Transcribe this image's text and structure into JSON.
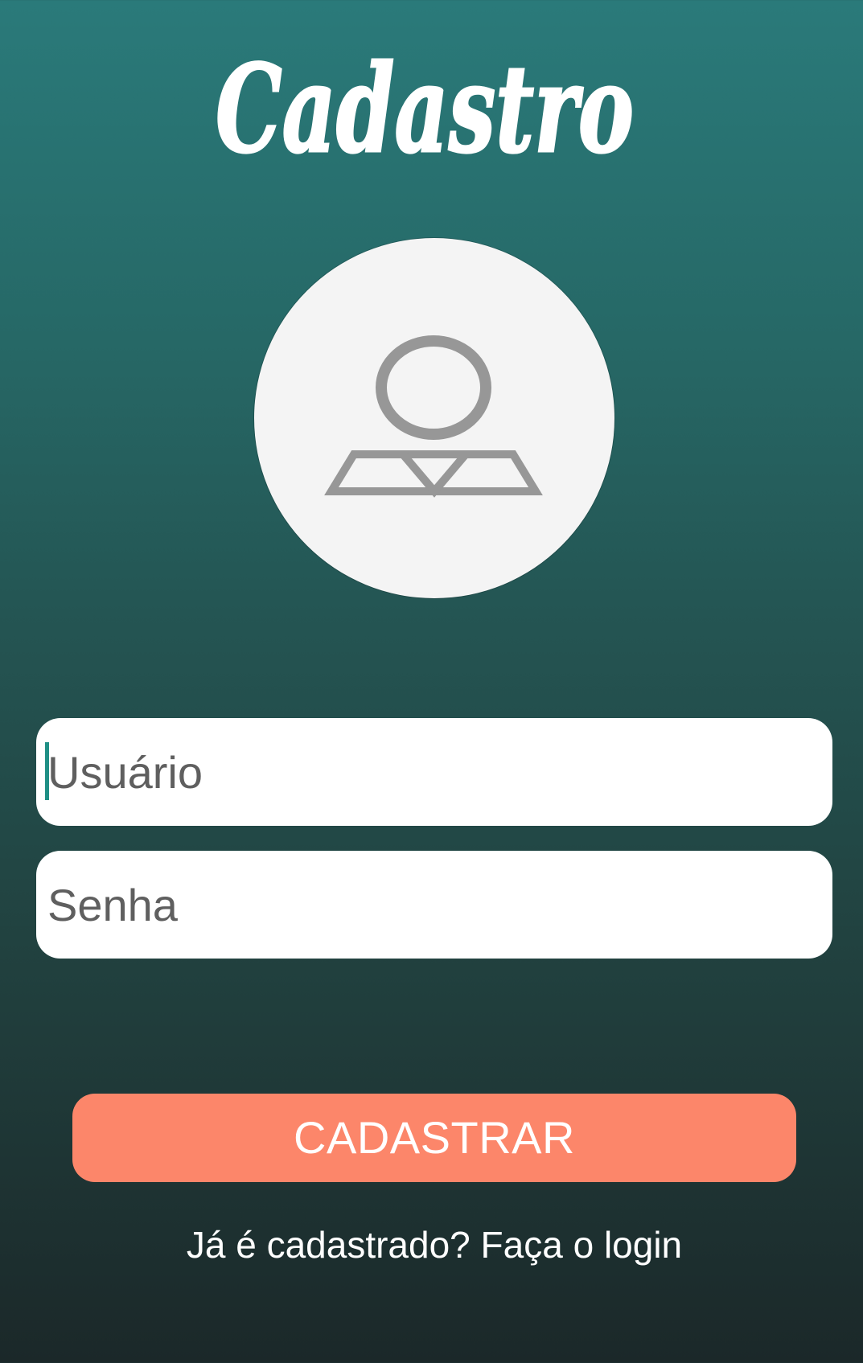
{
  "app": {
    "title": "Cadastro"
  },
  "avatar": {
    "icon": "user-placeholder-icon"
  },
  "form": {
    "username_placeholder": "Usuário",
    "username_value": "",
    "password_placeholder": "Senha",
    "password_value": ""
  },
  "actions": {
    "submit_label": "CADASTRAR",
    "login_link": "Já é cadastrado? Faça o login"
  },
  "colors": {
    "background_top": "#2a7a7a",
    "background_bottom": "#1b2829",
    "accent_button": "#fc866a",
    "cursor": "#1f8f85",
    "icon": "#979797"
  }
}
